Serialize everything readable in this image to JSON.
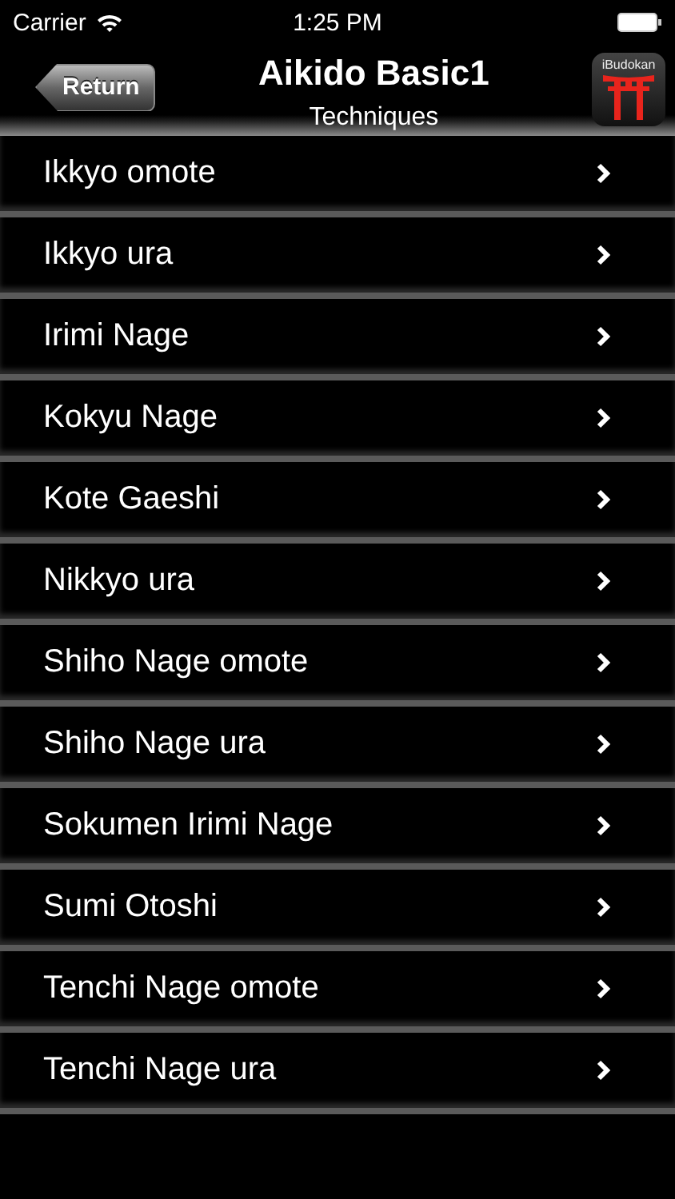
{
  "status_bar": {
    "carrier": "Carrier",
    "time": "1:25 PM"
  },
  "nav_bar": {
    "back_button": "Return",
    "title": "Aikido Basic1",
    "subtitle": "Techniques",
    "app_logo_text": "iBudokan"
  },
  "techniques": [
    {
      "label": "Ikkyo omote"
    },
    {
      "label": "Ikkyo ura"
    },
    {
      "label": "Irimi Nage"
    },
    {
      "label": "Kokyu Nage"
    },
    {
      "label": "Kote Gaeshi"
    },
    {
      "label": "Nikkyo ura"
    },
    {
      "label": "Shiho Nage omote"
    },
    {
      "label": "Shiho Nage ura"
    },
    {
      "label": "Sokumen Irimi Nage"
    },
    {
      "label": "Sumi Otoshi"
    },
    {
      "label": "Tenchi Nage omote"
    },
    {
      "label": "Tenchi Nage ura"
    }
  ]
}
